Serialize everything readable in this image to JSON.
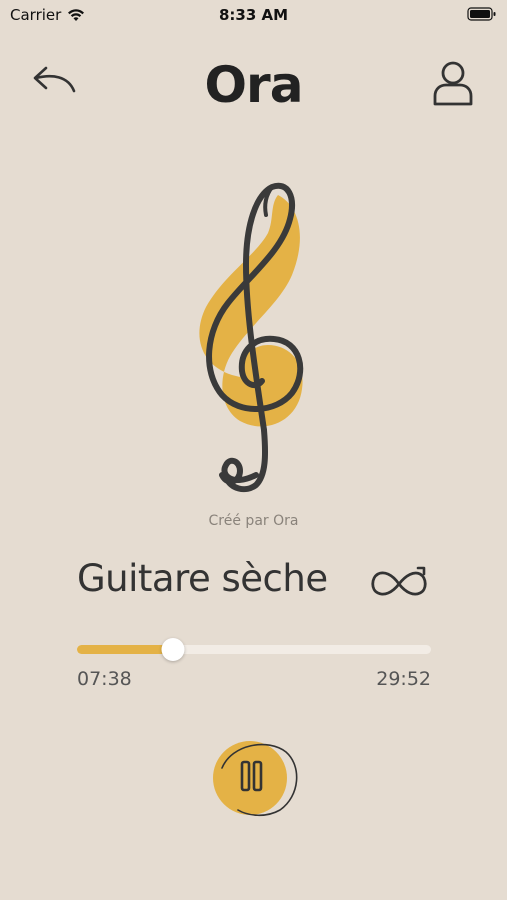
{
  "status_bar": {
    "carrier": "Carrier",
    "time": "8:33 AM"
  },
  "header": {
    "title": "Ora",
    "back_icon": "back-arrow-icon",
    "profile_icon": "user-profile-icon"
  },
  "artwork": {
    "icon": "treble-clef-icon",
    "credit": "Créé par Ora"
  },
  "player": {
    "track_title": "Guitare sèche",
    "loop_icon": "infinity-loop-icon",
    "progress_fraction": 0.27,
    "elapsed": "07:38",
    "total": "29:52",
    "pause_icon": "pause-icon"
  },
  "colors": {
    "background": "#e5dcd1",
    "accent": "#e4b246",
    "track": "#f2ece5",
    "ink": "#333333"
  }
}
